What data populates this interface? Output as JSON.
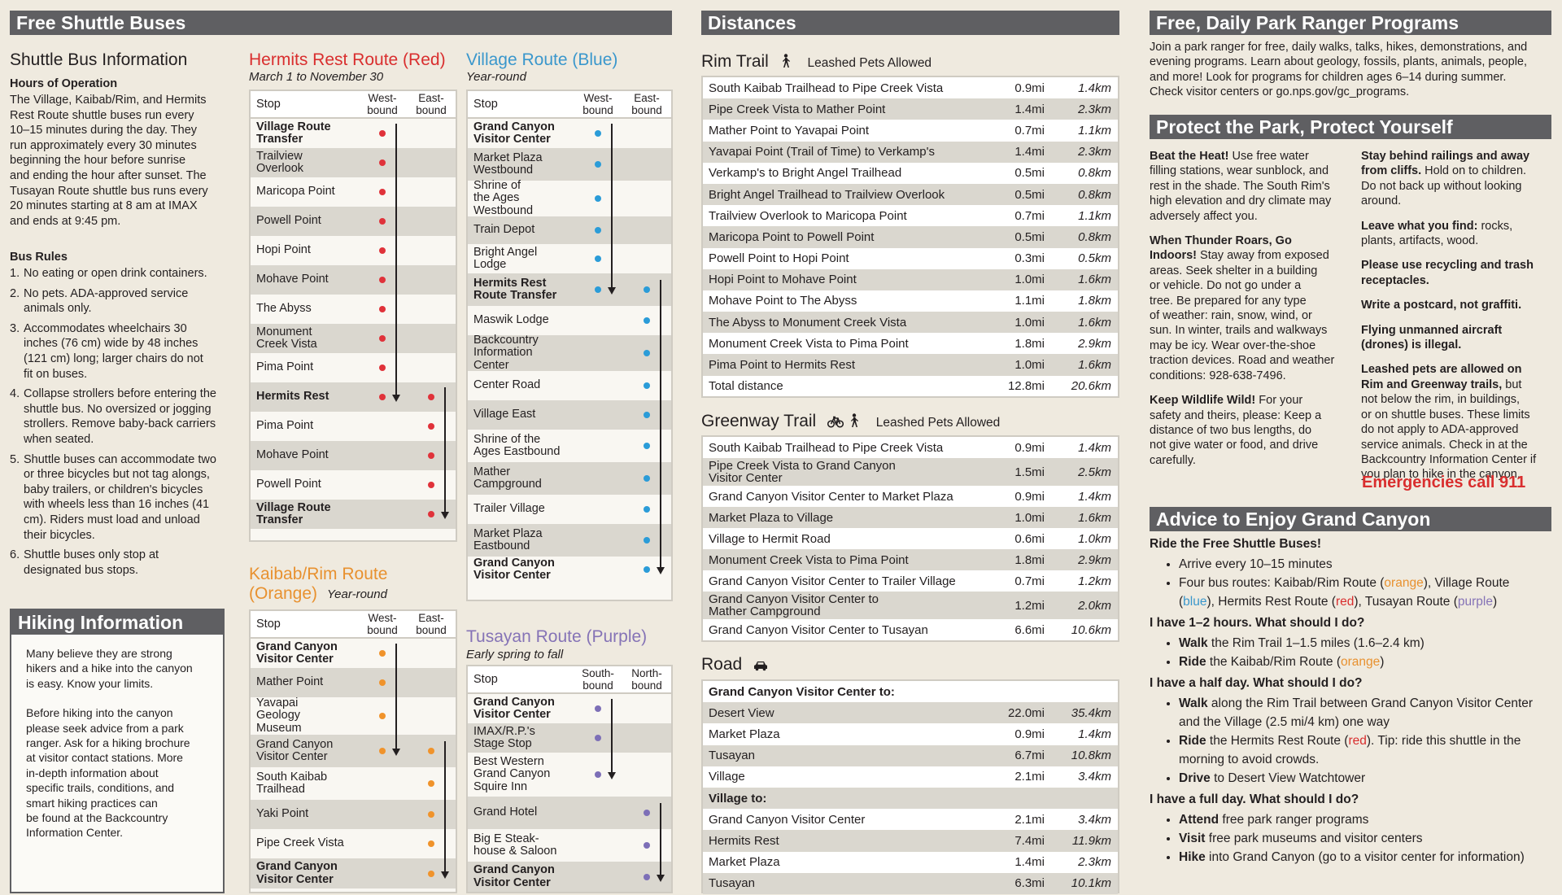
{
  "colors": {
    "red": "#e0323a",
    "blue": "#2b9cd8",
    "orange": "#f0932b",
    "purple": "#7d6fb7",
    "red_text": "#d92e2e",
    "blue_text": "#3a97cc",
    "orange_text": "#e8912f",
    "purple_text": "#8573b6"
  },
  "shuttle": {
    "header": "Free Shuttle Buses",
    "info_title": "Shuttle Bus Information",
    "hours_title": "Hours of Operation",
    "hours_lines": [
      "The Village, Kaibab/Rim, and Hermits",
      "Rest Route shuttle buses run every",
      "10–15 minutes during the day. They",
      "run approximately every 30 minutes",
      "beginning the hour before sunrise",
      "and ending the hour after sunset. The",
      "Tusayan Route shuttle bus runs every",
      "20 minutes starting at 8 am at IMAX",
      "and ends at 9:45 pm."
    ],
    "rules_title": "Bus Rules",
    "rules": [
      {
        "num": "1.",
        "lines": [
          "No eating or open drink containers."
        ]
      },
      {
        "num": "2.",
        "lines": [
          "No pets. ADA-approved service",
          "animals only."
        ]
      },
      {
        "num": "3.",
        "lines": [
          "Accommodates wheelchairs 30",
          "inches (76 cm) wide by 48 inches",
          "(121 cm) long; larger chairs do not",
          "fit on buses."
        ]
      },
      {
        "num": "4.",
        "lines": [
          "Collapse strollers before entering the",
          "shuttle bus. No oversized or jogging",
          "strollers. Remove baby-back carriers",
          "when seated."
        ]
      },
      {
        "num": "5.",
        "lines": [
          "Shuttle buses can accommodate two",
          "or three bicycles but not tag alongs,",
          "baby trailers, or children's bicycles",
          "with wheels less than 16 inches (41",
          "cm). Riders must load and unload",
          "their bicycles."
        ]
      },
      {
        "num": "6.",
        "lines": [
          "Shuttle buses only stop at",
          "designated bus stops."
        ]
      }
    ]
  },
  "hiking": {
    "header": "Hiking Information",
    "paras": [
      [
        "Many believe they are strong",
        "hikers and a hike into the canyon",
        "is easy. Know your limits."
      ],
      [
        "Before hiking into the canyon",
        "please seek advice from a park",
        "ranger. Ask for a hiking brochure",
        "at visitor contact stations. More",
        "in-depth information about",
        "specific trails, conditions, and",
        "smart hiking practices can",
        "be found at the Backcountry",
        "Information Center."
      ]
    ]
  },
  "routes": [
    {
      "key": "red",
      "title": "Hermits Rest Route (Red)",
      "subtitle": "March 1 to November 30",
      "headers": [
        "Stop",
        "West-\nbound",
        "East-\nbound"
      ],
      "rows": [
        {
          "name": "Village Route\nTransfer",
          "bold": true,
          "w": true,
          "e": false
        },
        {
          "name": "Trailview\nOverlook",
          "bold": false,
          "w": true,
          "e": false
        },
        {
          "name": "Maricopa Point",
          "bold": false,
          "w": true,
          "e": false
        },
        {
          "name": "Powell Point",
          "bold": false,
          "w": true,
          "e": false
        },
        {
          "name": "Hopi Point",
          "bold": false,
          "w": true,
          "e": false
        },
        {
          "name": "Mohave Point",
          "bold": false,
          "w": true,
          "e": false
        },
        {
          "name": "The Abyss",
          "bold": false,
          "w": true,
          "e": false
        },
        {
          "name": "Monument\nCreek Vista",
          "bold": false,
          "w": true,
          "e": false
        },
        {
          "name": "Pima Point",
          "bold": false,
          "w": true,
          "e": false
        },
        {
          "name": "Hermits Rest",
          "bold": true,
          "w": true,
          "e": true
        },
        {
          "name": "Pima Point",
          "bold": false,
          "w": false,
          "e": true
        },
        {
          "name": "Mohave Point",
          "bold": false,
          "w": false,
          "e": true
        },
        {
          "name": "Powell Point",
          "bold": false,
          "w": false,
          "e": true
        },
        {
          "name": "Village Route\nTransfer",
          "bold": true,
          "w": false,
          "e": true
        }
      ]
    },
    {
      "key": "blue",
      "title": "Village Route (Blue)",
      "subtitle": "Year-round",
      "headers": [
        "Stop",
        "West-\nbound",
        "East-\nbound"
      ],
      "rows": [
        {
          "name": "Grand Canyon\nVisitor Center",
          "bold": true,
          "w": true,
          "e": false
        },
        {
          "name": "Market Plaza\nWestbound",
          "bold": false,
          "w": true,
          "e": false
        },
        {
          "name": "Shrine of\nthe Ages\nWestbound",
          "bold": false,
          "w": true,
          "e": false
        },
        {
          "name": "Train Depot",
          "bold": false,
          "w": true,
          "e": false
        },
        {
          "name": "Bright Angel\nLodge",
          "bold": false,
          "w": true,
          "e": false
        },
        {
          "name": "Hermits Rest\nRoute Transfer",
          "bold": true,
          "w": true,
          "e": true
        },
        {
          "name": "Maswik Lodge",
          "bold": false,
          "w": false,
          "e": true
        },
        {
          "name": "Backcountry\nInformation\nCenter",
          "bold": false,
          "w": false,
          "e": true
        },
        {
          "name": "Center Road",
          "bold": false,
          "w": false,
          "e": true
        },
        {
          "name": "Village East",
          "bold": false,
          "w": false,
          "e": true
        },
        {
          "name": "Shrine of the\nAges Eastbound",
          "bold": false,
          "w": false,
          "e": true
        },
        {
          "name": "Mather\nCampground",
          "bold": false,
          "w": false,
          "e": true
        },
        {
          "name": "Trailer Village",
          "bold": false,
          "w": false,
          "e": true
        },
        {
          "name": "Market Plaza\nEastbound",
          "bold": false,
          "w": false,
          "e": true
        },
        {
          "name": "Grand Canyon\nVisitor Center",
          "bold": true,
          "w": false,
          "e": true
        }
      ]
    },
    {
      "key": "orange",
      "title": "Kaibab/Rim Route",
      "title2": "(Orange)",
      "subtitle": "Year-round",
      "headers": [
        "Stop",
        "West-\nbound",
        "East-\nbound"
      ],
      "rows": [
        {
          "name": "Grand Canyon\nVisitor Center",
          "bold": true,
          "w": true,
          "e": false
        },
        {
          "name": "Mather Point",
          "bold": false,
          "w": true,
          "e": false
        },
        {
          "name": "Yavapai\nGeology\nMuseum",
          "bold": false,
          "w": true,
          "e": false
        },
        {
          "name": "Grand Canyon\nVisitor Center",
          "bold": false,
          "w": true,
          "e": true
        },
        {
          "name": "South Kaibab\nTrailhead",
          "bold": false,
          "w": false,
          "e": true
        },
        {
          "name": "Yaki Point",
          "bold": false,
          "w": false,
          "e": true
        },
        {
          "name": "Pipe Creek Vista",
          "bold": false,
          "w": false,
          "e": true
        },
        {
          "name": "Grand Canyon\nVisitor Center",
          "bold": true,
          "w": false,
          "e": true
        }
      ]
    },
    {
      "key": "purple",
      "title": "Tusayan Route (Purple)",
      "subtitle": "Early spring to fall",
      "headers": [
        "Stop",
        "South-\nbound",
        "North-\nbound"
      ],
      "rows": [
        {
          "name": "Grand Canyon\nVisitor Center",
          "bold": true,
          "w": true,
          "e": false
        },
        {
          "name": "IMAX/R.P.'s\nStage Stop",
          "bold": false,
          "w": true,
          "e": false
        },
        {
          "name": "Best Western\nGrand Canyon\nSquire Inn",
          "bold": false,
          "w": true,
          "e": false
        },
        {
          "name": "Grand Hotel",
          "bold": false,
          "w": false,
          "e": true
        },
        {
          "name": "Big E Steak-\nhouse & Saloon",
          "bold": false,
          "w": false,
          "e": true
        },
        {
          "name": "Grand Canyon\nVisitor Center",
          "bold": true,
          "w": false,
          "e": true
        }
      ]
    }
  ],
  "distances": {
    "header": "Distances",
    "rim": {
      "title": "Rim Trail",
      "pets": "Leashed Pets Allowed",
      "rows": [
        [
          "South Kaibab Trailhead to Pipe Creek Vista",
          "0.9mi",
          "1.4km"
        ],
        [
          "Pipe Creek Vista to Mather Point",
          "1.4mi",
          "2.3km"
        ],
        [
          "Mather Point to Yavapai Point",
          "0.7mi",
          "1.1km"
        ],
        [
          "Yavapai Point (Trail of Time) to Verkamp's",
          "1.4mi",
          "2.3km"
        ],
        [
          "Verkamp's to Bright Angel Trailhead",
          "0.5mi",
          "0.8km"
        ],
        [
          "Bright Angel Trailhead to Trailview Overlook",
          "0.5mi",
          "0.8km"
        ],
        [
          "Trailview Overlook to Maricopa Point",
          "0.7mi",
          "1.1km"
        ],
        [
          "Maricopa Point to Powell Point",
          "0.5mi",
          "0.8km"
        ],
        [
          "Powell Point to Hopi Point",
          "0.3mi",
          "0.5km"
        ],
        [
          "Hopi Point to Mohave Point",
          "1.0mi",
          "1.6km"
        ],
        [
          "Mohave Point to The Abyss",
          "1.1mi",
          "1.8km"
        ],
        [
          "The Abyss to Monument Creek Vista",
          "1.0mi",
          "1.6km"
        ],
        [
          "Monument Creek Vista to Pima Point",
          "1.8mi",
          "2.9km"
        ],
        [
          "Pima Point to Hermits Rest",
          "1.0mi",
          "1.6km"
        ],
        [
          "Total distance",
          "12.8mi",
          "20.6km"
        ]
      ]
    },
    "greenway": {
      "title": "Greenway Trail",
      "pets": "Leashed Pets Allowed",
      "rows": [
        [
          "South Kaibab Trailhead to Pipe Creek Vista",
          "0.9mi",
          "1.4km"
        ],
        [
          "Pipe Creek Vista to Grand Canyon\nVisitor Center",
          "1.5mi",
          "2.5km"
        ],
        [
          "Grand Canyon Visitor Center to Market Plaza",
          "0.9mi",
          "1.4km"
        ],
        [
          "Market Plaza to Village",
          "1.0mi",
          "1.6km"
        ],
        [
          "Village to Hermit Road",
          "0.6mi",
          "1.0km"
        ],
        [
          "Monument Creek Vista to Pima Point",
          "1.8mi",
          "2.9km"
        ],
        [
          "Grand Canyon Visitor Center to Trailer Village",
          "0.7mi",
          "1.2km"
        ],
        [
          "Grand Canyon Visitor Center to\nMather Campground",
          "1.2mi",
          "2.0km"
        ],
        [
          "Grand Canyon Visitor Center to Tusayan",
          "6.6mi",
          "10.6km"
        ]
      ]
    },
    "road": {
      "title": "Road",
      "rows": [
        [
          "Grand Canyon Visitor Center to:",
          "",
          ""
        ],
        [
          "Desert View",
          "22.0mi",
          "35.4km"
        ],
        [
          "Market Plaza",
          "0.9mi",
          "1.4km"
        ],
        [
          "Tusayan",
          "6.7mi",
          "10.8km"
        ],
        [
          "Village",
          "2.1mi",
          "3.4km"
        ],
        [
          "Village to:",
          "",
          ""
        ],
        [
          "Grand Canyon Visitor Center",
          "2.1mi",
          "3.4km"
        ],
        [
          "Hermits Rest",
          "7.4mi",
          "11.9km"
        ],
        [
          "Market Plaza",
          "1.4mi",
          "2.3km"
        ],
        [
          "Tusayan",
          "6.3mi",
          "10.1km"
        ]
      ]
    }
  },
  "ranger": {
    "header": "Free, Daily Park Ranger Programs",
    "lines": [
      "Join a park ranger for free, daily walks, talks, hikes, demonstrations, and",
      "evening programs. Learn about geology, fossils, plants, animals, people,",
      "and more! Look for programs for children ages 6–14 during summer.",
      "Check visitor centers or go.nps.gov/gc_programs."
    ]
  },
  "protect": {
    "header": "Protect the Park, Protect Yourself",
    "left": [
      {
        "bold": "Beat the Heat!",
        "lines": [
          " Use free water",
          "filling stations, wear sunblock, and",
          "rest in the shade. The South Rim's",
          "high elevation and dry climate may",
          "adversely affect you."
        ]
      },
      {
        "bold": "When Thunder Roars, Go\nIndoors!",
        "lines": [
          " Stay away from exposed",
          "areas. Seek shelter in a building",
          "or vehicle. Do not go under a",
          "tree. Be prepared for any type",
          "of weather: rain, snow, wind, or",
          "sun. In winter, trails and walkways",
          "may be icy. Wear over-the-shoe",
          "traction devices. Road and weather",
          "conditions: 928-638-7496."
        ]
      },
      {
        "bold": "Keep Wildlife Wild!",
        "lines": [
          " For your",
          "safety and theirs, please: Keep a",
          "distance of two bus lengths, do",
          "not give water or food, and drive",
          "carefully."
        ]
      }
    ],
    "right": [
      {
        "bold": "Stay behind railings and away\nfrom cliffs.",
        "lines": [
          " Hold on to children.",
          "Do not back up without looking",
          "around."
        ]
      },
      {
        "bold": "Leave what you find:",
        "lines": [
          " rocks,",
          "plants, artifacts, wood."
        ]
      },
      {
        "bold": "Please use recycling and trash\nreceptacles.",
        "lines": []
      },
      {
        "bold": "Write a postcard, not graffiti.",
        "lines": []
      },
      {
        "bold": "Flying unmanned aircraft\n(drones) is illegal.",
        "lines": []
      },
      {
        "bold": "Leashed pets are allowed on\nRim and Greenway trails,",
        "lines": [
          " but",
          "not below the rim, in buildings,",
          "or on shuttle buses. These limits",
          "do not apply to ADA-approved",
          "service animals. Check in at the",
          "Backcountry Information Center if",
          "you plan to hike in the canyon."
        ]
      }
    ],
    "emergency": "Emergencies call 911"
  },
  "advice": {
    "header": "Advice to Enjoy Grand Canyon",
    "q1": "Ride the Free Shuttle Buses!",
    "a1_1": "Arrive every 10–15 minutes",
    "a1_2_pre": "Four bus routes: Kaibab/Rim Route (",
    "a1_2_or": "orange",
    "a1_2_mid1": "), Village Route",
    "a1_2_pre2": "(",
    "a1_2_bl": "blue",
    "a1_2_mid2": "), Hermits Rest Route (",
    "a1_2_rd": "red",
    "a1_2_mid3": "), Tusayan Route (",
    "a1_2_pu": "purple",
    "a1_2_end": ")",
    "q2": "I have 1–2 hours. What should I do?",
    "a2_1b": "Walk",
    "a2_1": " the Rim Trail 1–1.5 miles (1.6–2.4 km)",
    "a2_2b": "Ride",
    "a2_2": " the Kaibab/Rim Route (",
    "a2_2c": "orange",
    "a2_2e": ")",
    "q3": "I have a half day. What should I do?",
    "a3_1b": "Walk",
    "a3_1": " along the Rim Trail between Grand Canyon Visitor Center",
    "a3_1l2": "and the Village (2.5 mi/4 km) one way",
    "a3_2b": "Ride",
    "a3_2": " the Hermits Rest Route (",
    "a3_2c": "red",
    "a3_2e": "). Tip: ride this shuttle in the",
    "a3_2l2": "morning to avoid crowds.",
    "a3_3b": "Drive",
    "a3_3": " to Desert View Watchtower",
    "q4": "I have a full day. What should I do?",
    "a4_1b": "Attend",
    "a4_1": " free park ranger programs",
    "a4_2b": "Visit",
    "a4_2": " free park museums and visitor centers",
    "a4_3b": "Hike",
    "a4_3": " into Grand Canyon (go to a visitor center for information)"
  }
}
